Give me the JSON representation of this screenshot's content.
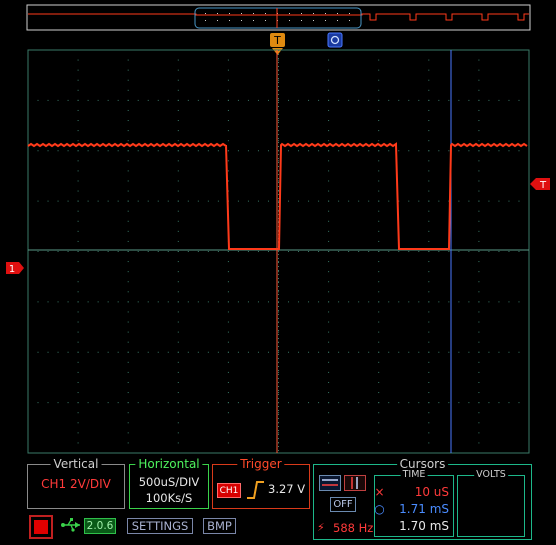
{
  "colors": {
    "trace": "#ff3a1a",
    "trigger_marker": "#ff2020",
    "cursor_blue": "#4a78ff",
    "grid": "#3a7a68",
    "trigger_orange": "#e08a10"
  },
  "markers": {
    "trigger_top": "T",
    "cursor_top": "",
    "ground_left": "1",
    "trigger_level_right": "T"
  },
  "vertical": {
    "title": "Vertical",
    "value": "CH1 2V/DIV"
  },
  "horizontal": {
    "title": "Horizontal",
    "timebase": "500uS/DIV",
    "samplerate": "100Ks/S"
  },
  "trigger": {
    "title": "Trigger",
    "channel": "CH1",
    "slope_icon": "rising-edge-icon",
    "level": "3.27 V"
  },
  "cursors": {
    "title": "Cursors",
    "off_label": "OFF",
    "frequency": "588 Hz",
    "time": {
      "title": "TIME",
      "cursor1_marker": "×",
      "cursor1": "10 uS",
      "cursor2_marker": "○",
      "cursor2": "1.71 mS",
      "delta": "1.70 mS"
    },
    "volts": {
      "title": "VOLTS"
    }
  },
  "toolbar": {
    "firmware": "2.0.6",
    "settings_label": "SETTINGS",
    "bmp_label": "BMP"
  }
}
